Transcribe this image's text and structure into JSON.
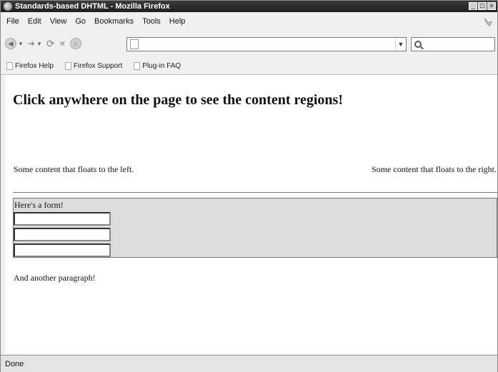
{
  "window": {
    "title": "Standards-based DHTML - Mozilla Firefox"
  },
  "menu": [
    "File",
    "Edit",
    "View",
    "Go",
    "Bookmarks",
    "Tools",
    "Help"
  ],
  "navigation": {
    "url_value": ""
  },
  "bookmarks": [
    "Firefox Help",
    "Firefox Support",
    "Plug-in FAQ"
  ],
  "page": {
    "heading": "Click anywhere on the page to see the content regions!",
    "left_float": "Some content that floats to the left.",
    "right_float": "Some content that floats to the right.",
    "form_label": "Here's a form!",
    "paragraph": "And another paragraph!"
  },
  "status": {
    "text": "Done"
  }
}
